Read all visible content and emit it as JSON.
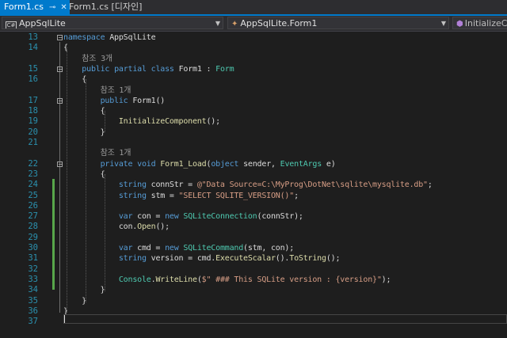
{
  "tabs": [
    {
      "label": "Form1.cs",
      "active": true
    },
    {
      "label": "Form1.cs [디자인]",
      "active": false
    }
  ],
  "icons": {
    "pin": "pin-icon",
    "close": "close-icon"
  },
  "nav": {
    "project": "AppSqlLite",
    "class": "AppSqlLite.Form1",
    "member": "InitializeCom"
  },
  "editor": {
    "lines": [
      {
        "n": "13",
        "text": "namespace AppSqlLite",
        "fold": true
      },
      {
        "n": "14",
        "text": "{",
        "fold": false
      },
      {
        "n": "",
        "text": "    참조 3개",
        "fold": false
      },
      {
        "n": "15",
        "text": "    public partial class Form1 : Form",
        "fold": true
      },
      {
        "n": "16",
        "text": "    {",
        "fold": false
      },
      {
        "n": "",
        "text": "        참조 1개",
        "fold": false
      },
      {
        "n": "17",
        "text": "        public Form1()",
        "fold": true
      },
      {
        "n": "18",
        "text": "        {",
        "fold": false
      },
      {
        "n": "19",
        "text": "            InitializeComponent();",
        "fold": false
      },
      {
        "n": "20",
        "text": "        }",
        "fold": false
      },
      {
        "n": "21",
        "text": "",
        "fold": false
      },
      {
        "n": "",
        "text": "        참조 1개",
        "fold": false
      },
      {
        "n": "22",
        "text": "        private void Form1_Load(object sender, EventArgs e)",
        "fold": true
      },
      {
        "n": "23",
        "text": "        {",
        "fold": false
      },
      {
        "n": "24",
        "text": "            string connStr = @\"Data Source=C:\\MyProg\\DotNet\\sqlite\\mysqlite.db\";",
        "fold": false
      },
      {
        "n": "25",
        "text": "            string stm = \"SELECT SQLITE_VERSION()\";",
        "fold": false
      },
      {
        "n": "26",
        "text": "",
        "fold": false
      },
      {
        "n": "27",
        "text": "            var con = new SQLiteConnection(connStr);",
        "fold": false
      },
      {
        "n": "28",
        "text": "            con.Open();",
        "fold": false
      },
      {
        "n": "29",
        "text": "",
        "fold": false
      },
      {
        "n": "30",
        "text": "            var cmd = new SQLiteCommand(stm, con);",
        "fold": false
      },
      {
        "n": "31",
        "text": "            string version = cmd.ExecuteScalar().ToString();",
        "fold": false
      },
      {
        "n": "32",
        "text": "",
        "fold": false
      },
      {
        "n": "33",
        "text": "            Console.WriteLine($\" ### This SQLite version : {version}\");",
        "fold": false
      },
      {
        "n": "34",
        "text": "        }",
        "fold": false
      },
      {
        "n": "35",
        "text": "    }",
        "fold": false
      },
      {
        "n": "36",
        "text": "}",
        "fold": false
      },
      {
        "n": "37",
        "text": "",
        "fold": false
      }
    ],
    "colors": {
      "keyword": "#569cd6",
      "type": "#4ec9b0",
      "string": "#d69d85",
      "method": "#dcdcaa",
      "lineNumber": "#2b91af",
      "changeMarker": "#57a64a",
      "accent": "#007acc"
    }
  }
}
